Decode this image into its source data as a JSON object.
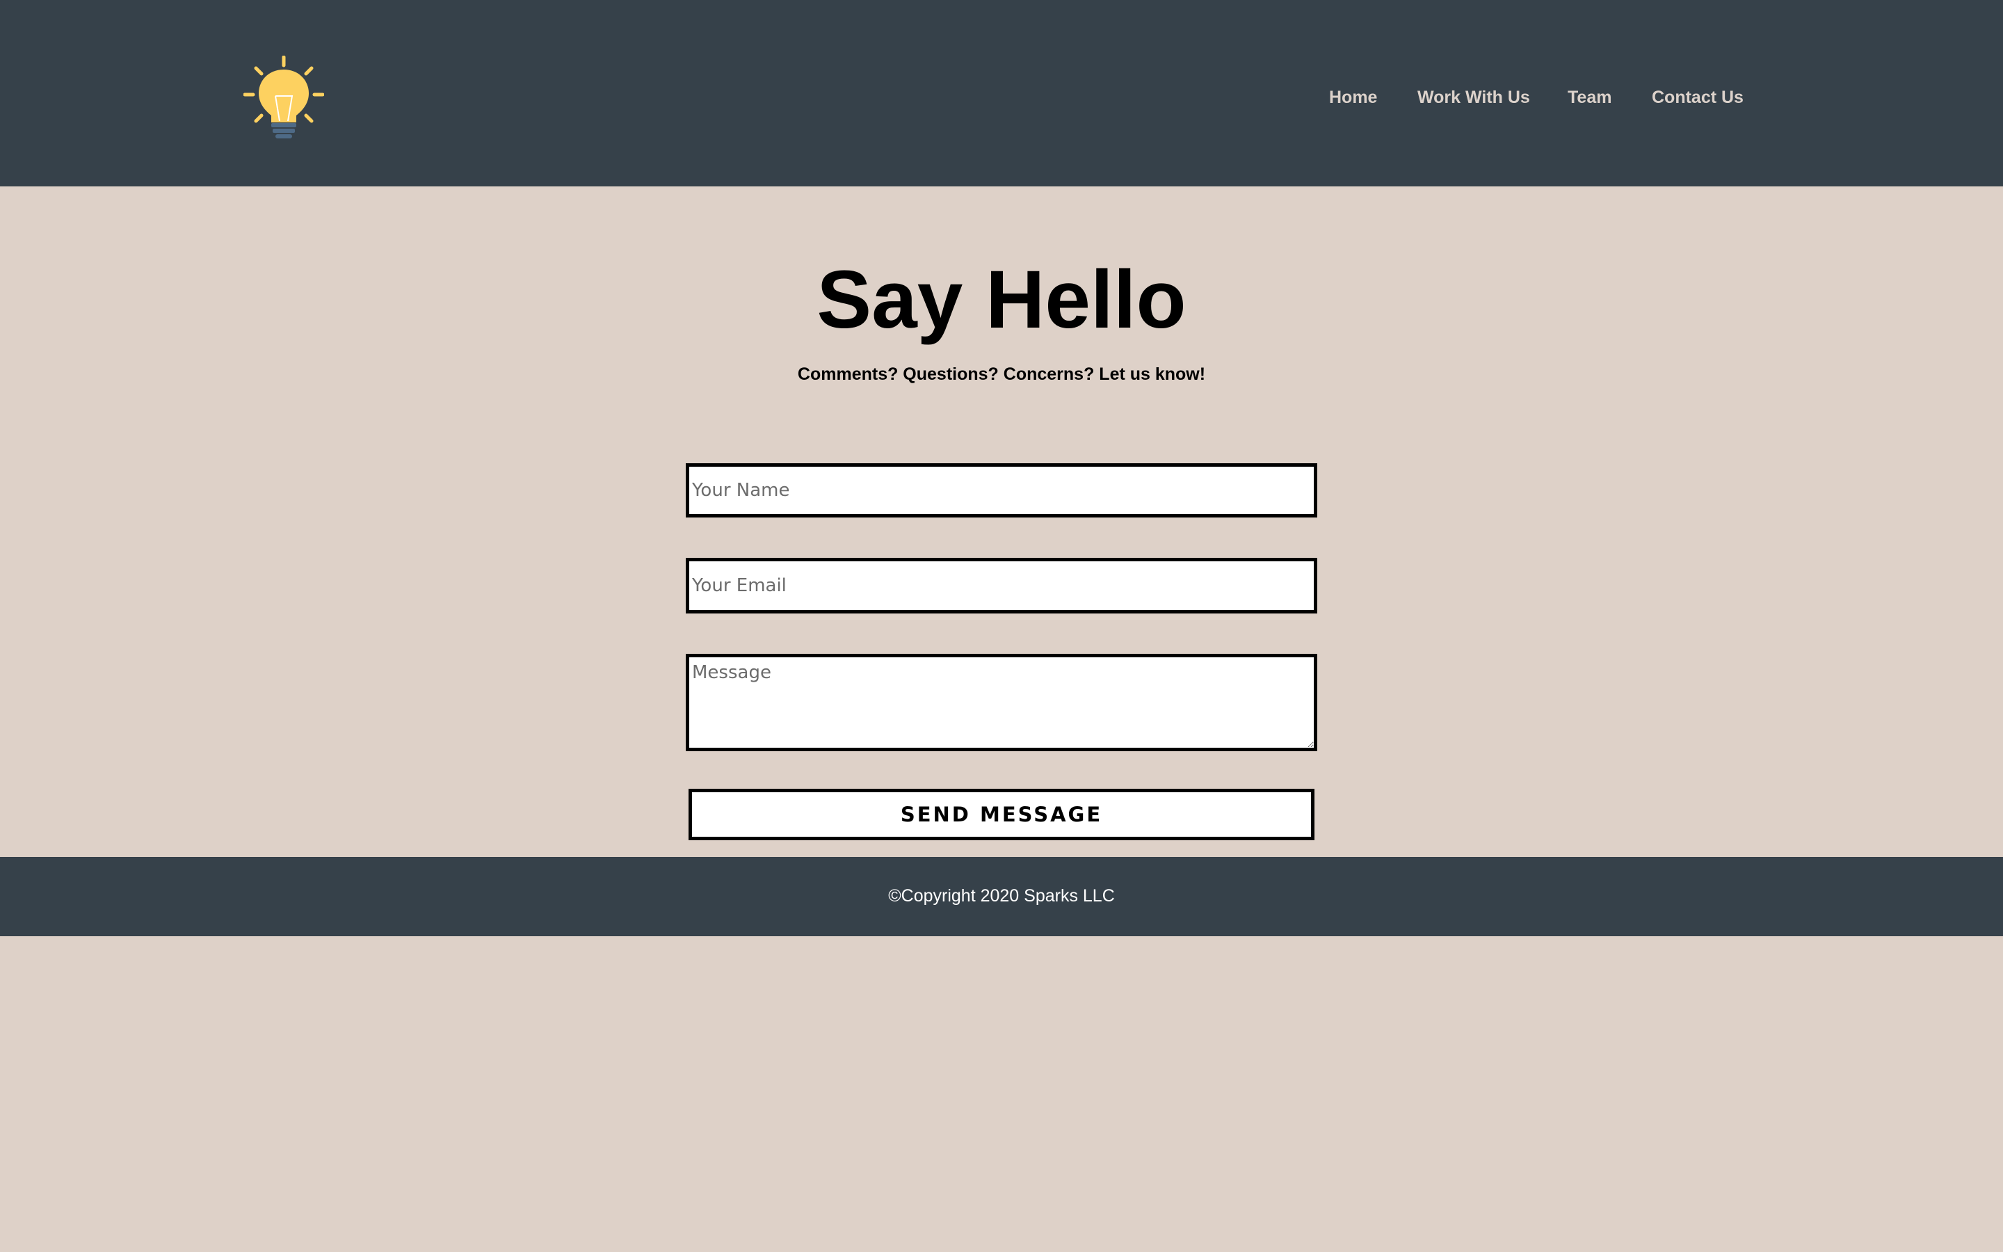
{
  "header": {
    "logo_icon": "lightbulb-icon",
    "nav": {
      "home": "Home",
      "work_with_us": "Work With Us",
      "team": "Team",
      "contact_us": "Contact Us"
    }
  },
  "main": {
    "title": "Say Hello",
    "subtitle": "Comments? Questions? Concerns? Let us know!",
    "form": {
      "name_placeholder": "Your Name",
      "email_placeholder": "Your Email",
      "message_placeholder": "Message",
      "send_label": "SEND MESSAGE"
    }
  },
  "footer": {
    "copyright": "©Copyright 2020 Sparks LLC"
  },
  "colors": {
    "header_bg": "#36414a",
    "page_bg": "#ded1c8",
    "nav_text": "#dcd2cb",
    "bulb_yellow": "#fdd160",
    "bulb_base": "#4e6a86"
  }
}
